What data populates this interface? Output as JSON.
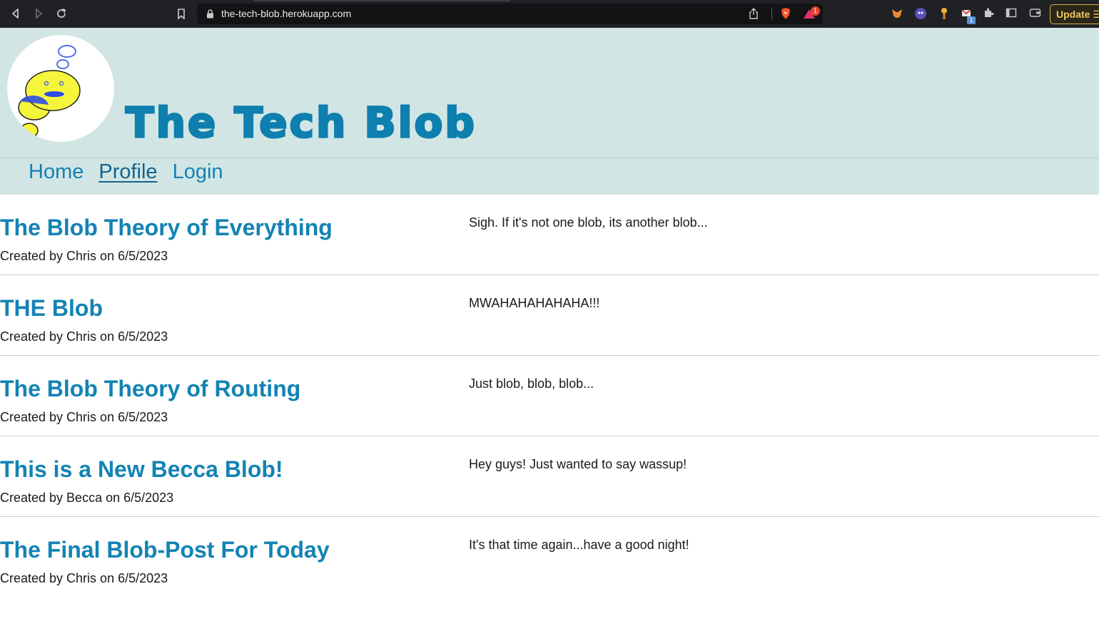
{
  "browser": {
    "url": "the-tech-blob.herokuapp.com",
    "update_label": "Update",
    "notification_count": "1",
    "extension_badge": "1"
  },
  "site": {
    "title": "The Tech Blob",
    "nav": [
      {
        "label": "Home",
        "active": false
      },
      {
        "label": "Profile",
        "active": true
      },
      {
        "label": "Login",
        "active": false
      }
    ]
  },
  "posts": [
    {
      "title": "The Blob Theory of Everything",
      "meta": "Created by Chris on 6/5/2023",
      "body": "Sigh. If it's not one blob, its another blob..."
    },
    {
      "title": "THE Blob",
      "meta": "Created by Chris on 6/5/2023",
      "body": "MWAHAHAHAHAHA!!!"
    },
    {
      "title": "The Blob Theory of Routing",
      "meta": "Created by Chris on 6/5/2023",
      "body": "Just blob, blob, blob..."
    },
    {
      "title": "This is a New Becca Blob!",
      "meta": "Created by Becca on 6/5/2023",
      "body": "Hey guys! Just wanted to say wassup!"
    },
    {
      "title": "The Final Blob-Post For Today",
      "meta": "Created by Chris on 6/5/2023",
      "body": "It's that time again...have a good night!"
    }
  ],
  "colors": {
    "header_bg": "#d1e6e4",
    "accent": "#1383b4",
    "title": "#0e7fae"
  }
}
